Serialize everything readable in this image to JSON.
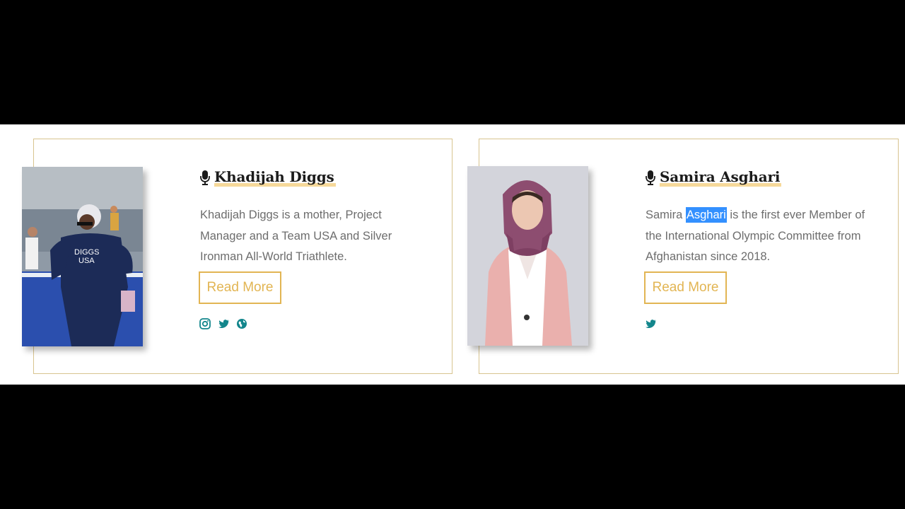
{
  "cards": [
    {
      "name": "Khadijah Diggs",
      "bio": "Khadijah Diggs is a mother, Project Manager and a Team USA and Silver Ironman All-World Triathlete.",
      "button_label": "Read More",
      "social_icons": [
        "instagram-icon",
        "twitter-icon",
        "globe-icon"
      ],
      "photo_text": {
        "line1": "DIGGS",
        "line2": "USA"
      }
    },
    {
      "name": "Samira Asghari",
      "bio_before": "Samira ",
      "bio_selected": "Asghari",
      "bio_after": " is the first ever Member of the International Olympic Committee from Afghanistan since 2018.",
      "button_label": "Read More",
      "social_icons": [
        "twitter-icon"
      ]
    }
  ],
  "colors": {
    "card_border": "#d8c48f",
    "accent_gold": "#e2b553",
    "name_underline": "#f6d99a",
    "social_teal": "#13868c",
    "selection": "#3390ff"
  }
}
